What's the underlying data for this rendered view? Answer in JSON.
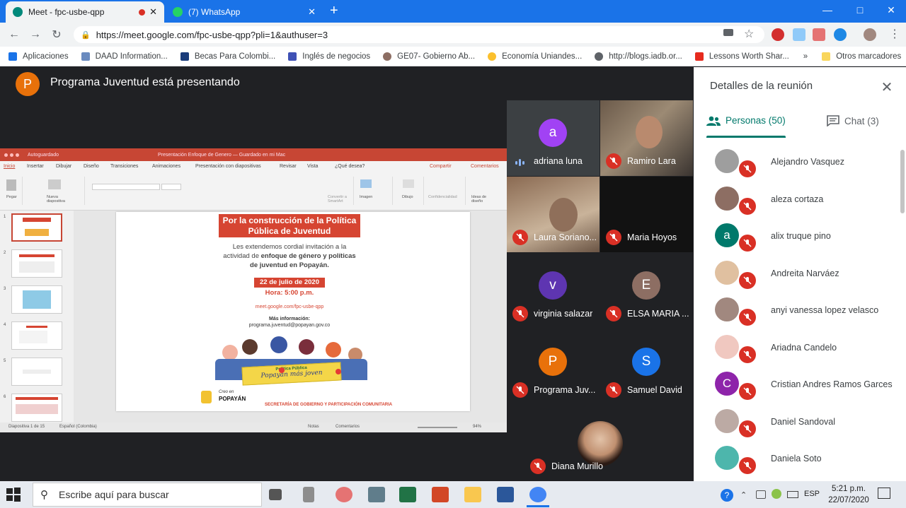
{
  "browser": {
    "tabs": [
      {
        "title": "Meet - fpc-usbe-qpp",
        "active": true
      },
      {
        "title": "(7) WhatsApp",
        "active": false
      }
    ],
    "new_tab": "+",
    "close_glyph": "✕",
    "url": "https://meet.google.com/fpc-usbe-qpp?pli=1&authuser=3",
    "bookmarks": [
      "Aplicaciones",
      "DAAD Information...",
      "Becas Para Colombi...",
      "Inglés de negocios",
      "GE07- Gobierno Ab...",
      "Economía Uniandes...",
      "http://blogs.iadb.or...",
      "Lessons Worth Shar...",
      "»",
      "Otros marcadores"
    ]
  },
  "meet": {
    "presenter_initial": "P",
    "presenter_banner": "Programa Juventud está presentando",
    "tiles": [
      {
        "name": "adriana luna",
        "initial": "a",
        "color": "#a142f4",
        "mic": "speaking"
      },
      {
        "name": "Ramiro Lara",
        "initial": "",
        "color": "#3b3b3b",
        "mic": "muted",
        "video": true
      },
      {
        "name": "Laura Soriano...",
        "initial": "",
        "color": "#5a4a3e",
        "mic": "muted",
        "video": true
      },
      {
        "name": "Maria Hoyos",
        "initial": "",
        "color": "#141414",
        "mic": "muted",
        "video": true
      },
      {
        "name": "virginia salazar",
        "initial": "v",
        "color": "#5e35b1",
        "mic": "muted"
      },
      {
        "name": "ELSA MARIA ...",
        "initial": "E",
        "color": "#8d6e63",
        "mic": "muted"
      },
      {
        "name": "Programa Juv...",
        "initial": "P",
        "color": "#e8710a",
        "mic": "muted"
      },
      {
        "name": "Samuel David",
        "initial": "S",
        "color": "#1a73e8",
        "mic": "muted"
      },
      {
        "name": "Diana Murillo",
        "initial": "",
        "color": "#d9c2b4",
        "mic": "muted",
        "video": true
      }
    ]
  },
  "panel": {
    "title": "Detalles de la reunión",
    "tab_people": "Personas (50)",
    "tab_chat": "Chat (3)",
    "people": [
      {
        "name": "Alejandro Vasquez",
        "initial": "",
        "color": "#9e9e9e"
      },
      {
        "name": "aleza cortaza",
        "initial": "",
        "color": "#8d6e63"
      },
      {
        "name": "alix truque pino",
        "initial": "a",
        "color": "#00796b"
      },
      {
        "name": "Andreita Narváez",
        "initial": "",
        "color": "#e0c0a0"
      },
      {
        "name": "anyi vanessa lopez velasco",
        "initial": "",
        "color": "#a1887f"
      },
      {
        "name": "Ariadna Candelo",
        "initial": "",
        "color": "#f0c8c0"
      },
      {
        "name": "Cristian Andres Ramos Garces",
        "initial": "C",
        "color": "#8e24aa"
      },
      {
        "name": "Daniel Sandoval",
        "initial": "",
        "color": "#bcaaa4"
      },
      {
        "name": "Daniela Soto",
        "initial": "",
        "color": "#4db6ac"
      }
    ]
  },
  "ppt": {
    "title": "Presentación Enfoque de Genero — Guardado en mi Mac",
    "autosave": "Autoguardado",
    "tabs": [
      "Inicio",
      "Insertar",
      "Dibujar",
      "Diseño",
      "Transiciones",
      "Animaciones",
      "Presentación con diapositivas",
      "Revisar",
      "Vista",
      "¿Qué desea?"
    ],
    "share": "Compartir",
    "comments": "Comentarios",
    "ribbon_labels": [
      "Pegar",
      "Nueva diapositiva",
      "Convertir a SmartArt",
      "Imagen",
      "Dibujo",
      "Confidencialidad",
      "Ideas de diseño"
    ],
    "status_left": "Diapositiva 1 de 15",
    "status_lang": "Español (Colombia)",
    "status_notes": "Notas",
    "status_comments": "Comentarios",
    "zoom": "94%",
    "thumb_numbers": [
      "1",
      "2",
      "3",
      "4",
      "5",
      "6"
    ],
    "slide": {
      "heading_line1": "Por la construcción de la Política",
      "heading_line2": "Pública de Juventud",
      "invite_line1": "Les extendemos cordial invitación a la",
      "invite_line2a": "actividad de ",
      "invite_bold1": "enfoque de género y políticas",
      "invite_bold2": "de juventud en Popayán.",
      "date": "22 de julio de 2020",
      "time_label": "Hora:",
      "time_value": "5:00 p.m.",
      "link": "meet.google.com/fpc-usbe-qpp",
      "more_info": "Más información:",
      "email": "programa.juventud@popayan.gov.co",
      "banner_top": "Política Pública",
      "banner_script": "Popayán más joven",
      "logo_text_small": "Creo en",
      "logo_text_big": "POPAYÁN",
      "footer": "SECRETARÍA DE GOBIERNO Y PARTICIPACIÓN COMUNITARIA"
    }
  },
  "taskbar": {
    "search_placeholder": "Escribe aquí para buscar",
    "lang": "ESP",
    "time": "5:21 p.m.",
    "date": "22/07/2020"
  },
  "colors": {
    "chrome_blue": "#1a73e8",
    "meet_dark": "#202124",
    "muted_red": "#d93025",
    "people_teal": "#00796b",
    "ppt_red": "#c74634",
    "slide_heading_red": "#d64532"
  }
}
